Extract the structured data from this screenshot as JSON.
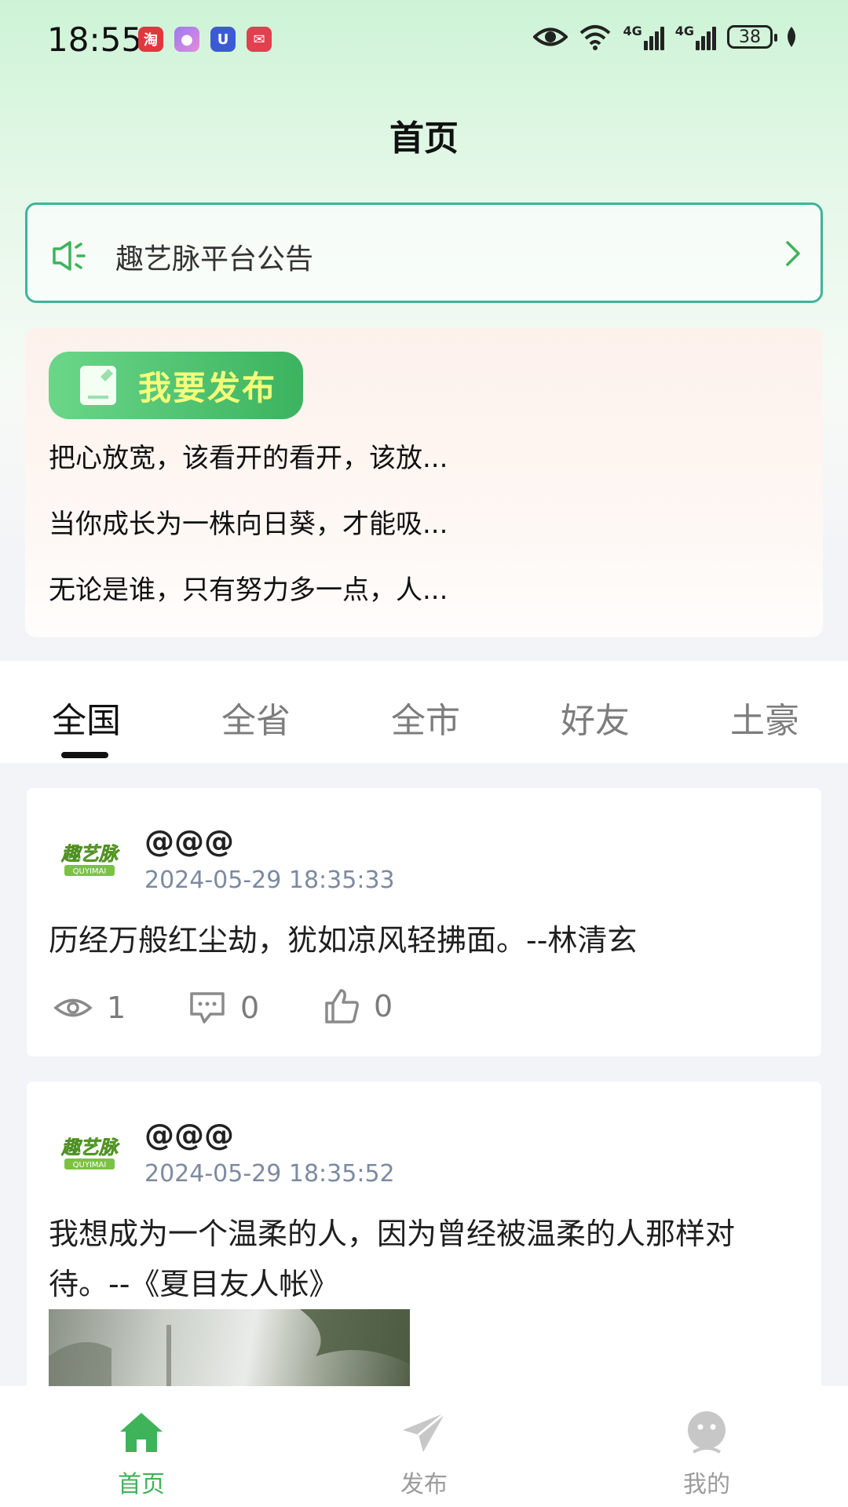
{
  "status_bar": {
    "time": "18:55",
    "app_icons": [
      "taobao-icon",
      "app-icon",
      "app-icon",
      "app-icon"
    ],
    "network_1": "4G",
    "network_2": "4G",
    "battery": "38"
  },
  "header": {
    "title": "首页"
  },
  "announcement": {
    "text": "趣艺脉平台公告"
  },
  "publish": {
    "button_label": "我要发布",
    "quotes": [
      "把心放宽，该看开的看开，该放...",
      "当你成长为一株向日葵，才能吸...",
      "无论是谁，只有努力多一点，人..."
    ]
  },
  "tabs": [
    {
      "label": "全国",
      "active": true
    },
    {
      "label": "全省",
      "active": false
    },
    {
      "label": "全市",
      "active": false
    },
    {
      "label": "好友",
      "active": false
    },
    {
      "label": "土豪",
      "active": false
    }
  ],
  "avatar": {
    "logo_text": "趣艺脉",
    "logo_subtext": "QUYIMAI"
  },
  "posts": [
    {
      "username": "@@@",
      "time": "2024-05-29 18:35:33",
      "content": "历经万般红尘劫，犹如凉风轻拂面。--林清玄",
      "views": "1",
      "comments": "0",
      "likes": "0"
    },
    {
      "username": "@@@",
      "time": "2024-05-29 18:35:52",
      "content": "我想成为一个温柔的人，因为曾经被温柔的人那样对待。--《夏目友人帐》",
      "has_image": true
    }
  ],
  "bottom_nav": [
    {
      "label": "首页",
      "icon": "home-icon",
      "active": true
    },
    {
      "label": "发布",
      "icon": "paper-plane-icon",
      "active": false
    },
    {
      "label": "我的",
      "icon": "profile-icon",
      "active": false
    }
  ],
  "colors": {
    "accent_green": "#3fb35a",
    "notice_border": "#3fb39b",
    "timestamp": "#7c8aa1",
    "publish_label": "#f6ff7a"
  }
}
